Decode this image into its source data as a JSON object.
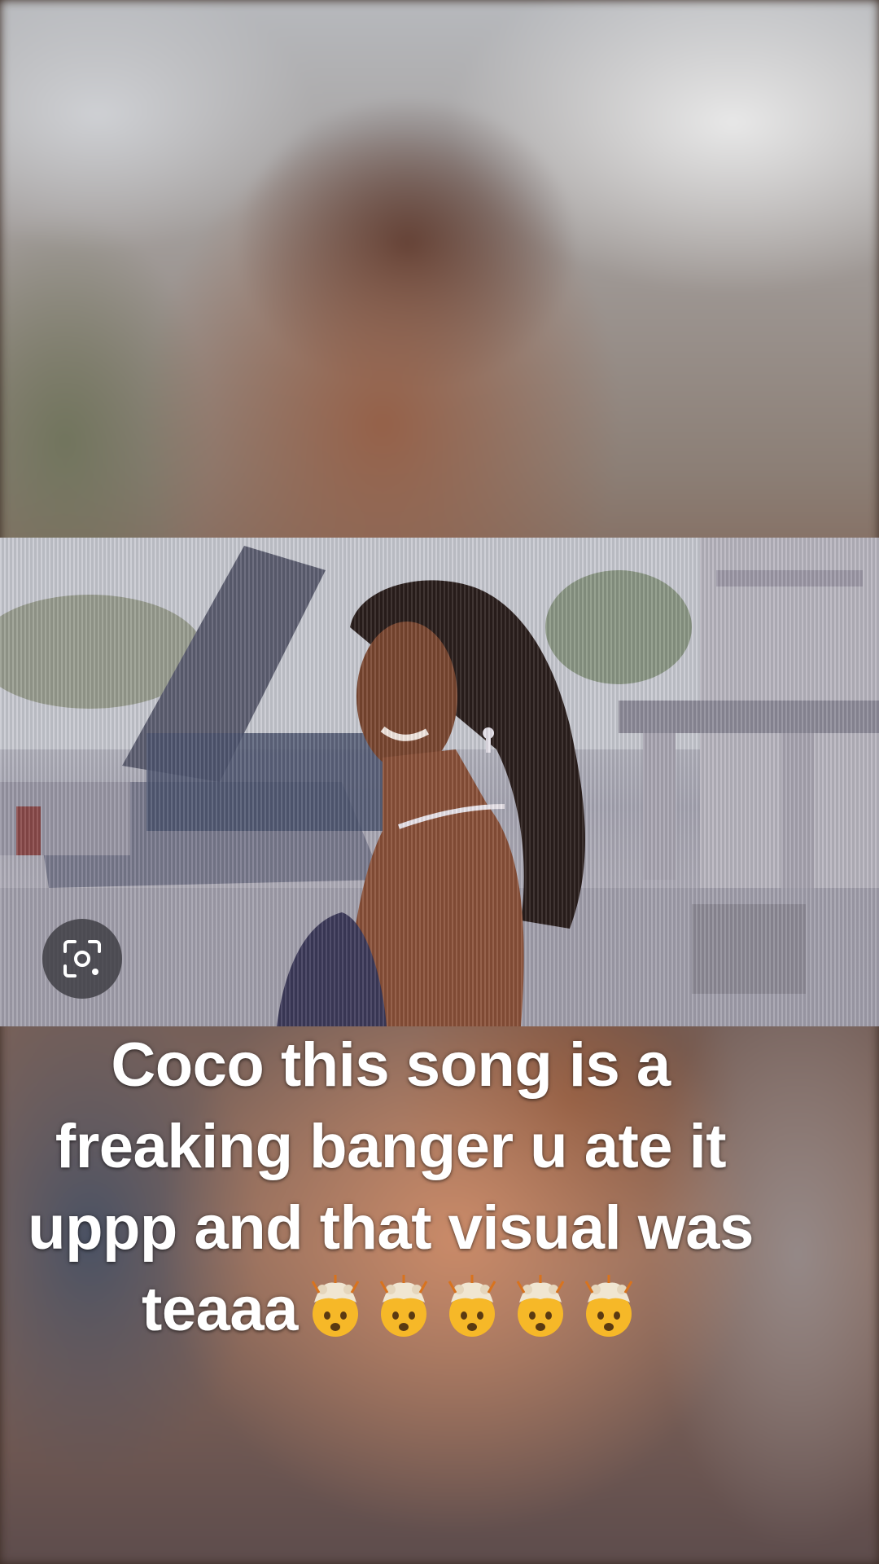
{
  "caption": {
    "line1": "Coco this song is a",
    "line2": "freaking banger u ate it",
    "line3": "uppp and that visual was",
    "line4_text": "teaaa",
    "emoji_name": "exploding-head-emoji",
    "emoji_count": 5
  },
  "photo": {
    "lens_button_icon": "image-search-icon"
  }
}
